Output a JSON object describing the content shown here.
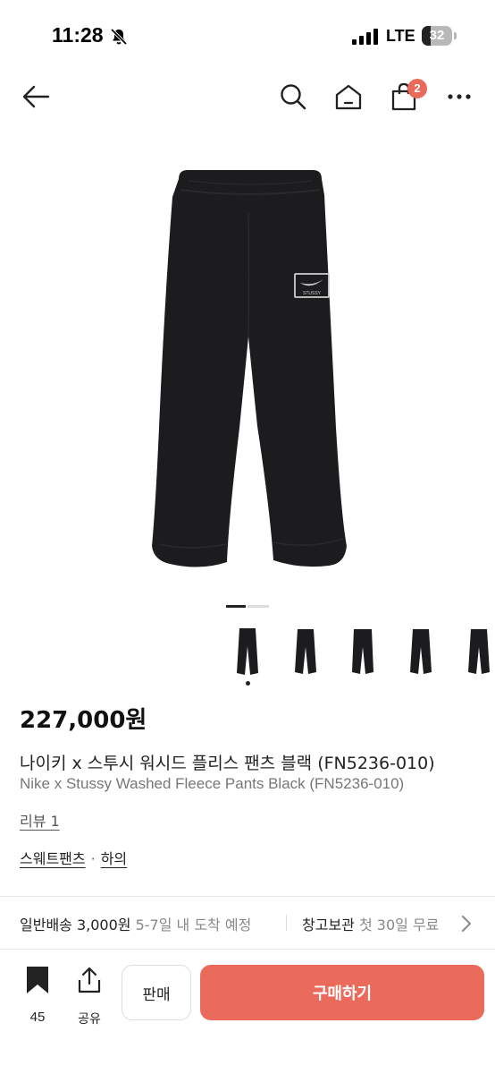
{
  "status_bar": {
    "time": "11:28",
    "network": "LTE",
    "battery": "32"
  },
  "nav": {
    "cart_count": "2",
    "icons": [
      "back-arrow-icon",
      "search-icon",
      "home-icon",
      "shopping-bag-icon",
      "more-icon"
    ]
  },
  "gallery": {
    "images_total": 2,
    "current_image": 1,
    "thumbnail_count": 5,
    "selected_thumbnail": 1
  },
  "product": {
    "price": "227,000원",
    "name_ko": "나이키 x 스투시 워시드 플리스 팬츠 블랙 (FN5236-010)",
    "name_en": "Nike x Stussy Washed Fleece Pants Black (FN5236-010)",
    "review_label": "리뷰 1",
    "category_1": "스웨트팬츠",
    "category_sep": "·",
    "category_2": "하의",
    "logo_text": "STUSSY"
  },
  "shipping": {
    "left_label": "일반배송 3,000원",
    "left_detail": "5-7일 내 도착 예정",
    "right_label": "창고보관",
    "right_detail": "첫 30일 무료"
  },
  "bottom": {
    "bookmark_count": "45",
    "share_label": "공유",
    "sell_label": "판매",
    "buy_label": "구매하기"
  },
  "colors": {
    "accent": "#ea6a5b",
    "badge": "#e96a5a"
  }
}
